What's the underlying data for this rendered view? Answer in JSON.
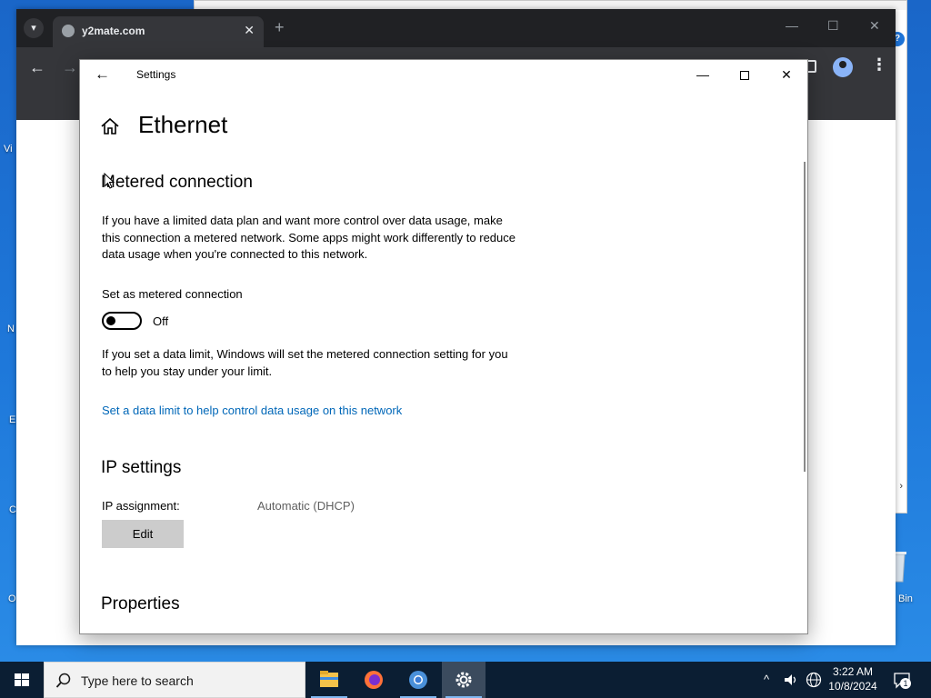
{
  "desktop": {
    "labels": [
      "Vi",
      "N",
      "E",
      "C",
      "O",
      "Bin"
    ]
  },
  "browser": {
    "tab_title": "y2mate.com",
    "tab_close": "✕",
    "new_tab": "+",
    "minimize": "—",
    "maximize": "☐",
    "close": "✕",
    "back": "←",
    "forward": "→",
    "menu": "⋮"
  },
  "settings": {
    "app_title": "Settings",
    "back_icon": "←",
    "page_title": "Ethernet",
    "metered": {
      "heading": "Metered connection",
      "description": "If you have a limited data plan and want more control over data usage, make this connection a metered network. Some apps might work differently to reduce data usage when you're connected to this network.",
      "toggle_label": "Set as metered connection",
      "toggle_state": "Off",
      "note": "If you set a data limit, Windows will set the metered connection setting for you to help you stay under your limit.",
      "link": "Set a data limit to help control data usage on this network"
    },
    "ip": {
      "heading": "IP settings",
      "assignment_label": "IP assignment:",
      "assignment_value": "Automatic (DHCP)",
      "edit_label": "Edit"
    },
    "properties": {
      "heading": "Properties"
    },
    "window_controls": {
      "minimize": "—",
      "close": "✕"
    }
  },
  "taskbar": {
    "search_placeholder": "Type here to search",
    "time": "3:22 AM",
    "date": "10/8/2024",
    "notification_count": "1",
    "tray_chevron": "^"
  },
  "colors": {
    "link": "#0067b8",
    "taskbar": "#0b1e33",
    "desktop": "#1e78da"
  }
}
